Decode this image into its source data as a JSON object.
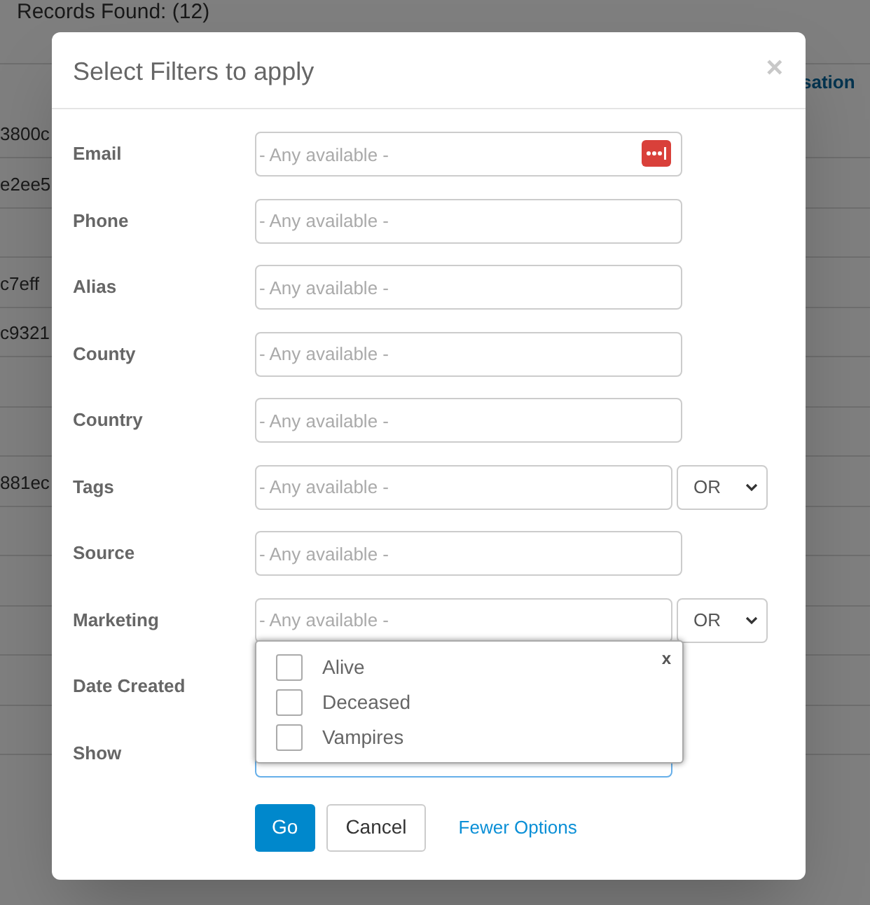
{
  "background": {
    "records_found": "Records Found: (12)",
    "column_header": "sation",
    "cells": [
      "3800c",
      "e2ee5",
      "",
      "c7eff",
      "c9321",
      "",
      "",
      "881ec",
      "",
      "",
      "",
      "",
      ""
    ]
  },
  "dialog": {
    "title": "Select Filters to apply",
    "close": "×",
    "fields": [
      {
        "label": "Email",
        "kind": "icon",
        "placeholder": "- Any available -"
      },
      {
        "label": "Phone",
        "kind": "plain",
        "placeholder": "- Any available -"
      },
      {
        "label": "Alias",
        "kind": "plain",
        "placeholder": "- Any available -"
      },
      {
        "label": "County",
        "kind": "plain",
        "placeholder": "- Any available -"
      },
      {
        "label": "Country",
        "kind": "plain",
        "placeholder": "- Any available -"
      },
      {
        "label": "Tags",
        "kind": "operator",
        "placeholder": "- Any available -",
        "operator": "OR"
      },
      {
        "label": "Source",
        "kind": "plain",
        "placeholder": "- Any available -"
      },
      {
        "label": "Marketing",
        "kind": "operator",
        "placeholder": "- Any available -",
        "operator": "OR"
      },
      {
        "label": "Date Created",
        "kind": "hidden"
      },
      {
        "label": "Show",
        "kind": "dropdown",
        "popup": {
          "close": "x",
          "options": [
            {
              "label": "Alive",
              "checked": false
            },
            {
              "label": "Deceased",
              "checked": false
            },
            {
              "label": "Vampires",
              "checked": false
            }
          ]
        }
      }
    ],
    "buttons": {
      "go": "Go",
      "cancel": "Cancel",
      "link": "Fewer Options"
    }
  }
}
